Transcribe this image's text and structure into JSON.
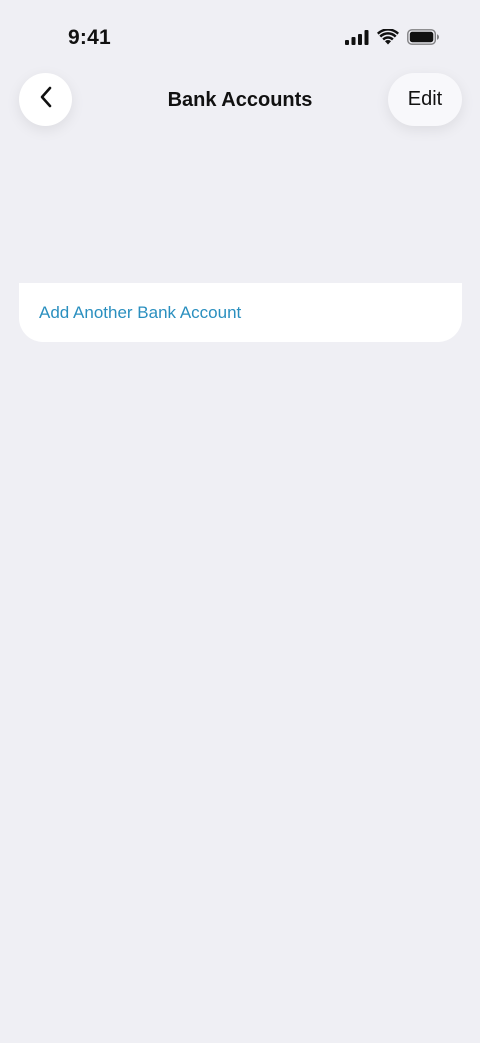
{
  "status_bar": {
    "time": "9:41",
    "icons": [
      "cellular-signal-icon",
      "wifi-icon",
      "battery-icon"
    ]
  },
  "nav": {
    "back_icon": "chevron-left-icon",
    "title": "Bank Accounts",
    "edit_label": "Edit"
  },
  "accounts_card": {
    "add_link": "Add Another Bank Account"
  },
  "colors": {
    "background": "#efeff4",
    "card": "#ffffff",
    "link": "#2a8fbf",
    "text": "#111111"
  }
}
